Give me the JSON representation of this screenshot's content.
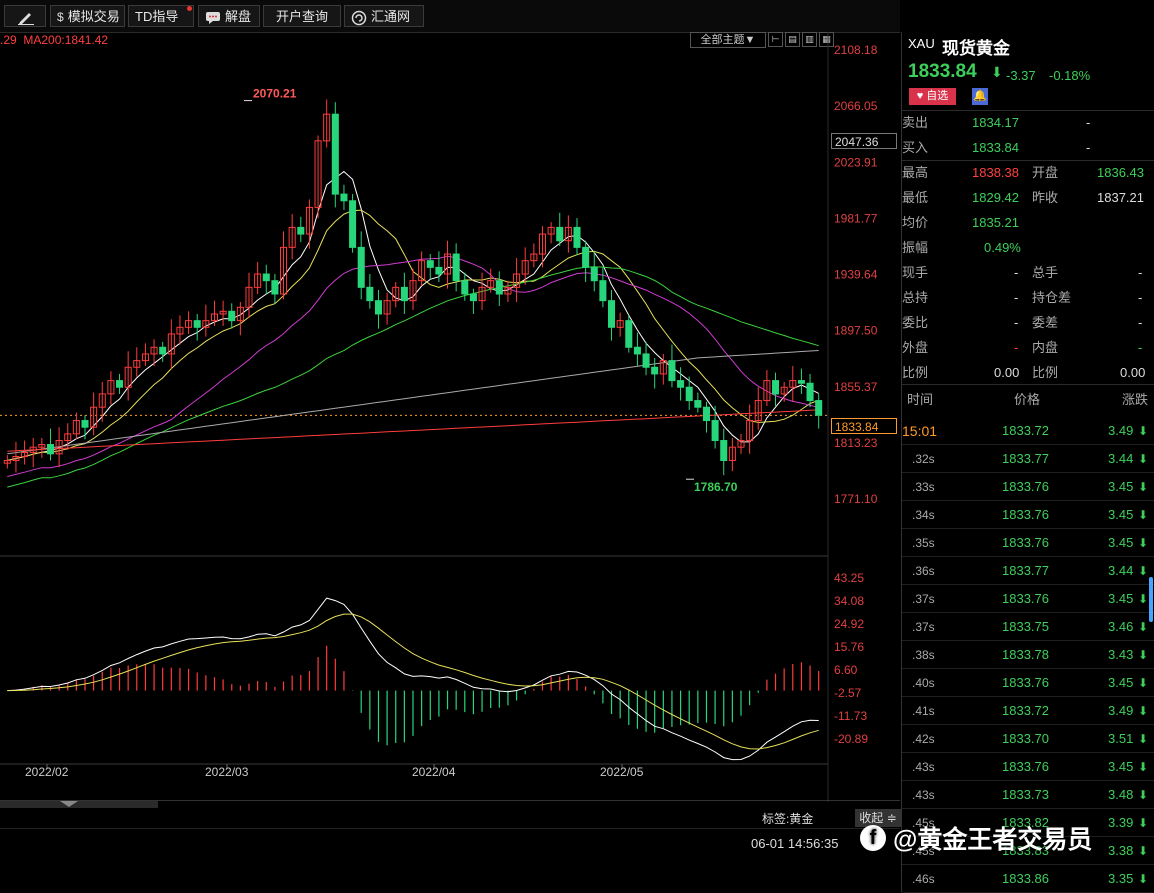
{
  "toolbar": {
    "buttons": [
      {
        "label": "",
        "icon": "pencil-icon"
      },
      {
        "label": "模拟交易",
        "icon": "dollar-icon"
      },
      {
        "label": "TD指导",
        "icon": ""
      },
      {
        "label": "解盘",
        "icon": "chat-icon"
      },
      {
        "label": "开户查询",
        "icon": ""
      },
      {
        "label": "汇通网",
        "icon": "logo-icon"
      }
    ]
  },
  "chart": {
    "ma_text_prefix": ".29",
    "ma_text": "MA200:1841.42",
    "theme_btn": "全部主题▼",
    "price_axis": [
      "2108.18",
      "2066.05",
      "2047.36",
      "2023.91",
      "1981.77",
      "1939.64",
      "1897.50",
      "1855.37",
      "1833.84",
      "1813.23",
      "1771.10"
    ],
    "current_price_tag": "1833.84",
    "high_label": "2070.21",
    "low_label": "1786.70",
    "macd_axis": [
      "43.25",
      "34.08",
      "24.92",
      "15.76",
      "6.60",
      "-2.57",
      "-11.73",
      "-20.89"
    ],
    "dates": [
      "2022/02",
      "2022/03",
      "2022/04",
      "2022/05"
    ],
    "tag_label": "标签:黄金",
    "collapse_label": "收起",
    "timestamp": "06-01 14:56:35",
    "watermark": "@黄金王者交易员"
  },
  "colors": {
    "up": "#ff3c3c",
    "down": "#27d67a",
    "ma5": "#ffffff",
    "ma10": "#e6e05a",
    "ma20": "#d23cd2",
    "ma60": "#3cd23c",
    "ma120": "#aaaaaa",
    "ma200": "#ff3c3c"
  },
  "quote": {
    "code": "XAU",
    "name": "现货黄金",
    "price": "1833.84",
    "change": "-3.37",
    "change_pct": "-0.18%",
    "watch_btn": "自选",
    "sell_label": "卖出",
    "sell_price": "1834.17",
    "sell_vol": "-",
    "buy_label": "买入",
    "buy_price": "1833.84",
    "buy_vol": "-",
    "high_label": "最高",
    "high": "1838.38",
    "open_label": "开盘",
    "open": "1836.43",
    "low_label": "最低",
    "low": "1829.42",
    "prev_label": "昨收",
    "prev": "1837.21",
    "avg_label": "均价",
    "avg": "1835.21",
    "amp_label": "振幅",
    "amp": "0.49%",
    "stats": [
      {
        "l1": "现手",
        "v1": "-",
        "l2": "总手",
        "v2": "-"
      },
      {
        "l1": "总持",
        "v1": "-",
        "l2": "持仓差",
        "v2": "-"
      },
      {
        "l1": "委比",
        "v1": "-",
        "l2": "委差",
        "v2": "-"
      },
      {
        "l1": "外盘",
        "v1": "-",
        "l2": "内盘",
        "v2": "-"
      },
      {
        "l1": "比例",
        "v1": "0.00",
        "l2": "比例",
        "v2": "0.00"
      }
    ]
  },
  "ticks": {
    "headers": [
      "时间",
      "价格",
      "涨跌"
    ],
    "rows": [
      {
        "time": "15:01",
        "price": "1833.72",
        "change": "3.49"
      },
      {
        "time": ".32s",
        "price": "1833.77",
        "change": "3.44"
      },
      {
        "time": ".33s",
        "price": "1833.76",
        "change": "3.45"
      },
      {
        "time": ".34s",
        "price": "1833.76",
        "change": "3.45"
      },
      {
        "time": ".35s",
        "price": "1833.76",
        "change": "3.45"
      },
      {
        "time": ".36s",
        "price": "1833.77",
        "change": "3.44"
      },
      {
        "time": ".37s",
        "price": "1833.76",
        "change": "3.45"
      },
      {
        "time": ".37s",
        "price": "1833.75",
        "change": "3.46"
      },
      {
        "time": ".38s",
        "price": "1833.78",
        "change": "3.43"
      },
      {
        "time": ".40s",
        "price": "1833.76",
        "change": "3.45"
      },
      {
        "time": ".41s",
        "price": "1833.72",
        "change": "3.49"
      },
      {
        "time": ".42s",
        "price": "1833.70",
        "change": "3.51"
      },
      {
        "time": ".43s",
        "price": "1833.76",
        "change": "3.45"
      },
      {
        "time": ".43s",
        "price": "1833.73",
        "change": "3.48"
      },
      {
        "time": ".45s",
        "price": "1833.82",
        "change": "3.39"
      },
      {
        "time": ".45s",
        "price": "1833.83",
        "change": "3.38"
      },
      {
        "time": ".46s",
        "price": "1833.86",
        "change": "3.35"
      }
    ]
  }
}
